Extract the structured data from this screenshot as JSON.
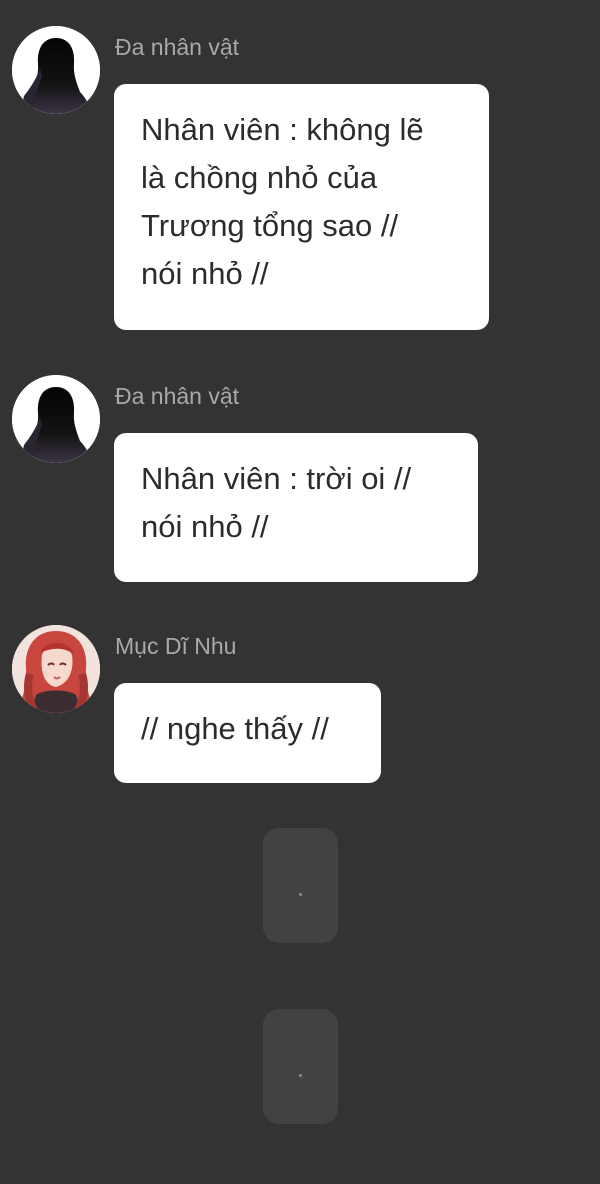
{
  "colors": {
    "background": "#333333",
    "bubble": "#ffffff",
    "bubble_text": "#2c2c2c",
    "sender_name": "#a9a9a9",
    "typing_placeholder": "#424242"
  },
  "messages": [
    {
      "sender": "Đa nhân vật",
      "avatar_icon": "silhouette-avatar-icon",
      "text": "Nhân viên : không lẽ\nlà chồng nhỏ của\nTrương tổng sao //\nnói nhỏ //"
    },
    {
      "sender": "Đa nhân vật",
      "avatar_icon": "silhouette-avatar-icon",
      "text": "Nhân viên : trời oi //\nnói nhỏ //"
    },
    {
      "sender": "Mục Dĩ Nhu",
      "avatar_icon": "red-haired-girl-avatar-icon",
      "text": "// nghe thấy //"
    }
  ],
  "typing_placeholders": [
    {
      "glyph": "."
    },
    {
      "glyph": "."
    }
  ]
}
